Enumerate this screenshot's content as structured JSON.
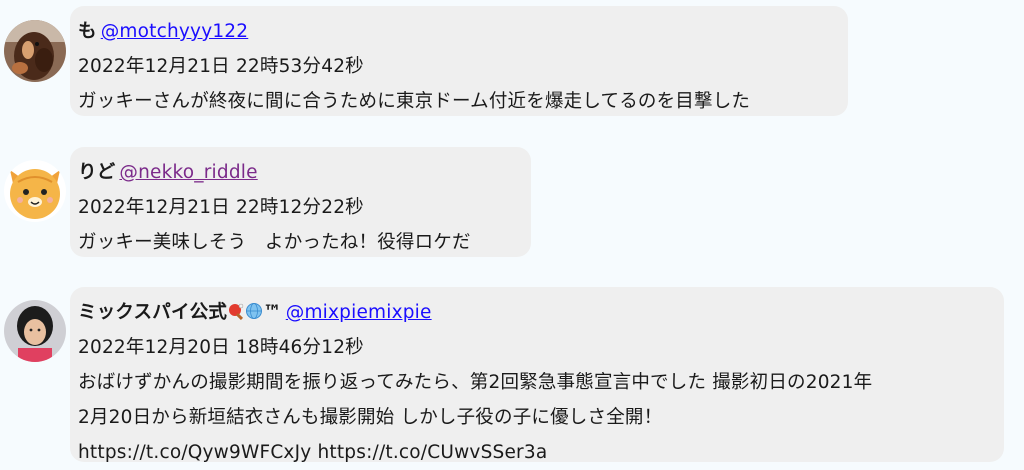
{
  "posts": [
    {
      "name": "も",
      "handle": "@motchyyy122",
      "handle_visited": false,
      "timestamp": "2022年12月21日 22時53分42秒",
      "text_lines": [
        "ガッキーさんが終夜に間に合うために東京ドーム付近を爆走してるのを目撃した"
      ],
      "avatar_icon": "horse-photo-avatar"
    },
    {
      "name": "りど",
      "handle": "@nekko_riddle",
      "handle_visited": true,
      "timestamp": "2022年12月21日 22時12分22秒",
      "text_lines": [
        "ガッキー美味しそう　よかったね！役得ロケだ"
      ],
      "avatar_icon": "cat-illustration-avatar"
    },
    {
      "name": "ミックスパイ公式",
      "name_suffix_icons": [
        "ping-pong-icon",
        "globe-icon"
      ],
      "name_suffix_text": "™",
      "handle": "@mixpiemixpie",
      "handle_visited": false,
      "timestamp": "2022年12月20日 18時46分12秒",
      "text_lines": [
        "おばけずかんの撮影期間を振り返ってみたら、第2回緊急事態宣言中でした 撮影初日の2021年",
        "2月20日から新垣結衣さんも撮影開始 しかし子役の子に優しさ全開！",
        "https://t.co/Qyw9WFCxJy https://t.co/CUwvSSer3a"
      ],
      "avatar_icon": "person-photo-avatar"
    }
  ],
  "colors": {
    "background": "#f6fbfe",
    "bubble": "#efefef",
    "link": "#1a0dff",
    "link_visited": "#7b2a8a"
  }
}
